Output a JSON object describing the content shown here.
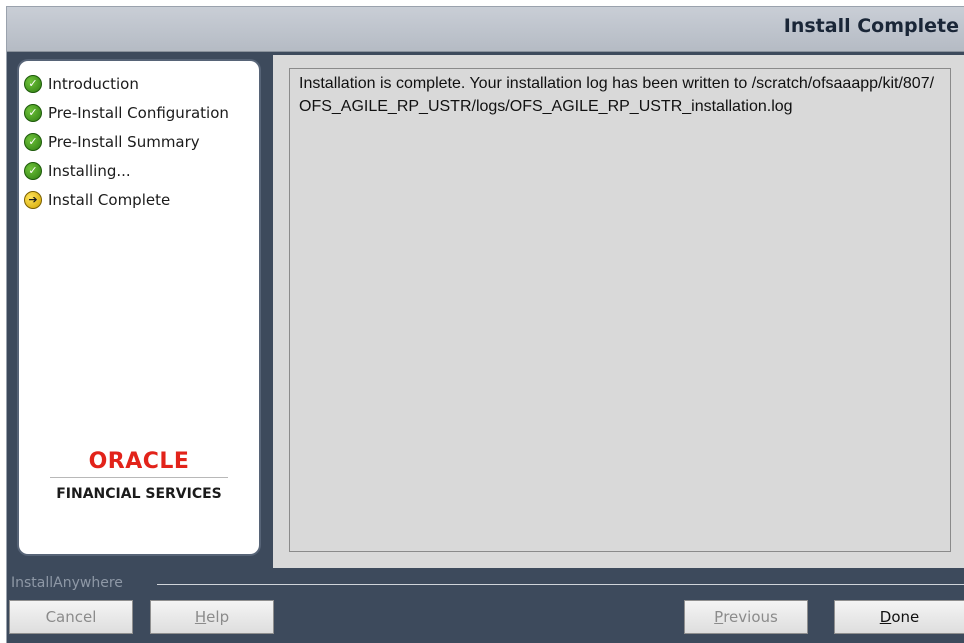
{
  "window": {
    "title": "Install Complete"
  },
  "steps": [
    {
      "label": "Introduction",
      "state": "done",
      "icon": "check-icon"
    },
    {
      "label": "Pre-Install Configuration",
      "state": "done",
      "icon": "check-icon"
    },
    {
      "label": "Pre-Install Summary",
      "state": "done",
      "icon": "check-icon"
    },
    {
      "label": "Installing...",
      "state": "done",
      "icon": "check-icon"
    },
    {
      "label": "Install Complete",
      "state": "current",
      "icon": "arrow-right-icon"
    }
  ],
  "branding": {
    "logo_text": "ORACLE",
    "subtitle": "FINANCIAL SERVICES",
    "logo_color": "#e2231a"
  },
  "content": {
    "message": "Installation is complete.  Your installation log has been written to /scratch/ofsaaapp/kit/807/OFS_AGILE_RP_USTR/logs/OFS_AGILE_RP_USTR_installation.log"
  },
  "footer": {
    "vendor_label": "InstallAnywhere",
    "buttons": {
      "cancel": {
        "label": "Cancel",
        "enabled": false
      },
      "help": {
        "label": "Help",
        "mnemonic": "H",
        "rest": "elp",
        "enabled": false
      },
      "previous": {
        "label": "Previous",
        "mnemonic": "P",
        "rest": "revious",
        "enabled": false
      },
      "done": {
        "label": "Done",
        "mnemonic": "D",
        "rest": "one",
        "enabled": true
      }
    }
  },
  "colors": {
    "frame": "#3d4a5c",
    "content_bg": "#d9d9d9",
    "done_icon": "#2e7d12",
    "current_icon": "#d2a400"
  }
}
